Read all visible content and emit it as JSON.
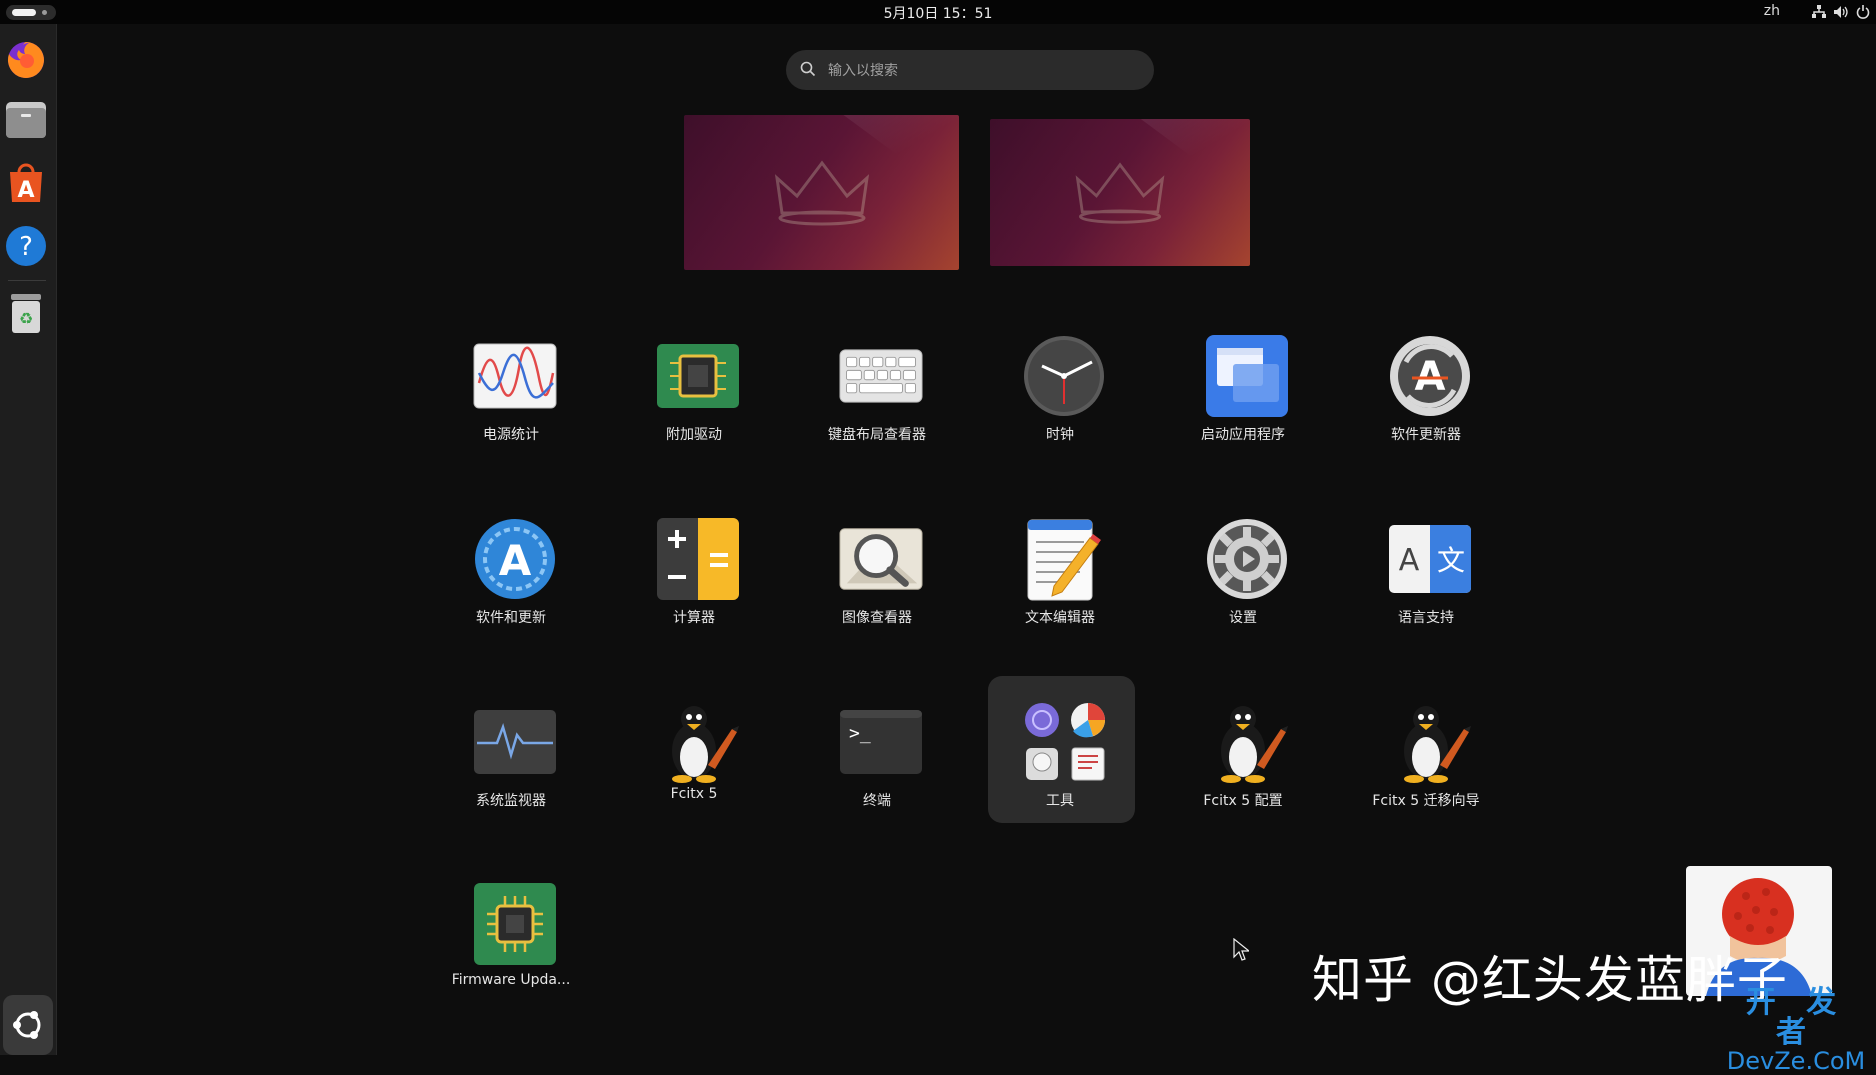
{
  "topbar": {
    "clock": "5月10日  15：51",
    "language": "zh"
  },
  "search": {
    "placeholder": "输入以搜索"
  },
  "dock": {
    "apps": [
      {
        "name": "Firefox",
        "icon": "firefox-icon"
      },
      {
        "name": "Files",
        "icon": "files-icon"
      },
      {
        "name": "App Center",
        "icon": "app-center-icon"
      },
      {
        "name": "Help",
        "icon": "help-icon"
      },
      {
        "name": "Trash",
        "icon": "trash-icon"
      }
    ],
    "show_apps_icon": "ubuntu-logo-icon"
  },
  "apps": [
    {
      "label": "电源统计",
      "icon": "power-statistics-icon"
    },
    {
      "label": "附加驱动",
      "icon": "additional-drivers-icon"
    },
    {
      "label": "键盘布局查看器",
      "icon": "keyboard-icon"
    },
    {
      "label": "时钟",
      "icon": "clock-icon"
    },
    {
      "label": "启动应用程序",
      "icon": "startup-apps-icon"
    },
    {
      "label": "软件更新器",
      "icon": "software-updater-icon"
    },
    {
      "label": "软件和更新",
      "icon": "software-sources-icon"
    },
    {
      "label": "计算器",
      "icon": "calculator-icon"
    },
    {
      "label": "图像查看器",
      "icon": "image-viewer-icon"
    },
    {
      "label": "文本编辑器",
      "icon": "text-editor-icon"
    },
    {
      "label": "设置",
      "icon": "settings-icon"
    },
    {
      "label": "语言支持",
      "icon": "language-support-icon"
    },
    {
      "label": "系统监视器",
      "icon": "system-monitor-icon"
    },
    {
      "label": "Fcitx 5",
      "icon": "tux-icon"
    },
    {
      "label": "终端",
      "icon": "terminal-icon"
    },
    {
      "label": "工具",
      "icon": "folder-icon"
    },
    {
      "label": "Fcitx 5 配置",
      "icon": "tux-icon"
    },
    {
      "label": "Fcitx 5 迁移向导",
      "icon": "tux-icon"
    },
    {
      "label": "Firmware Upda...",
      "icon": "firmware-icon"
    }
  ],
  "watermark": {
    "text": "知乎 @红头发蓝胖子",
    "site_cn": "开 发 者",
    "site_en": "DevZe.CoM"
  },
  "colors": {
    "background": "#0d0d0d",
    "dock": "#1e1e1e",
    "accent_orange": "#e95420"
  }
}
